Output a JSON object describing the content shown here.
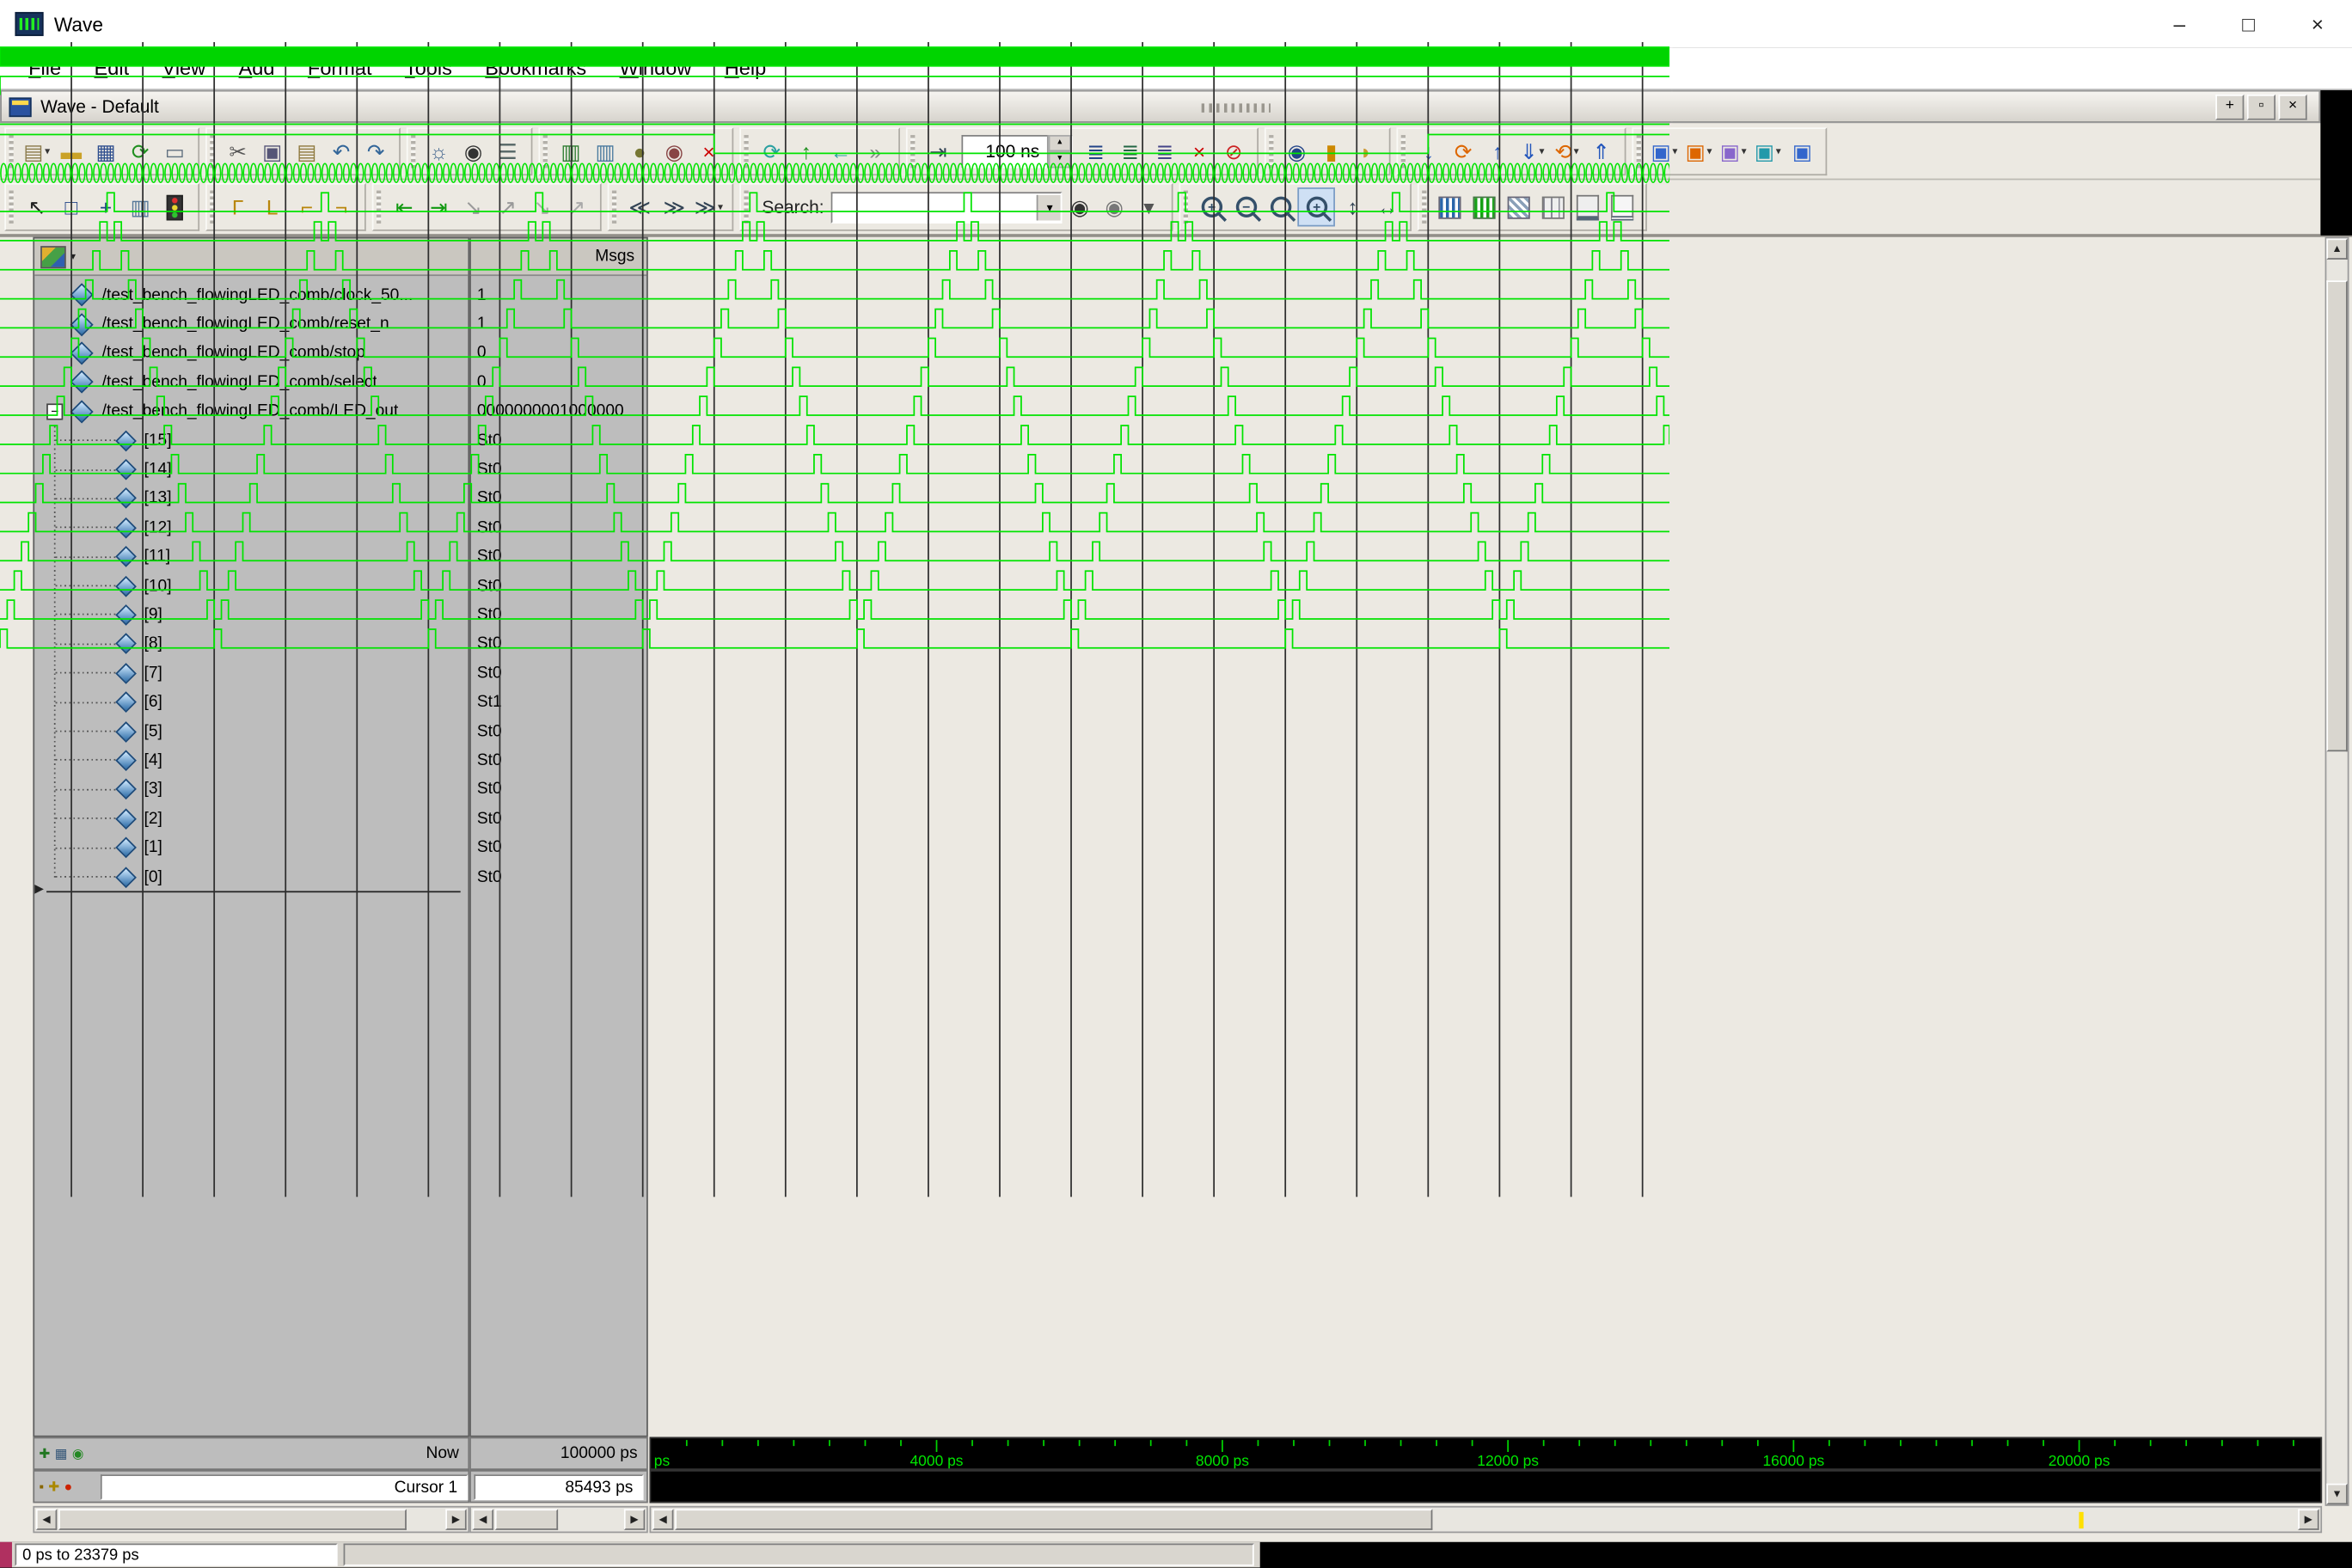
{
  "window": {
    "title": "Wave",
    "minimize": "–",
    "maximize": "□",
    "close": "×"
  },
  "menu": {
    "items": [
      "File",
      "Edit",
      "View",
      "Add",
      "Format",
      "Tools",
      "Bookmarks",
      "Window",
      "Help"
    ]
  },
  "pane": {
    "title": "Wave - Default",
    "buttons": [
      "+",
      "▫",
      "×"
    ]
  },
  "glyphs": {
    "dropdown": "▾",
    "spin_up": "▴",
    "spin_down": "▾",
    "left": "◀",
    "right": "▶",
    "up": "▲",
    "down": "▼",
    "insert_arrow": "▶",
    "expander": "−"
  },
  "run_length": {
    "value": "100 ns"
  },
  "toolbar2_search": {
    "label": "Search:",
    "value": ""
  },
  "columns": {
    "msgs_header": "Msgs"
  },
  "toolbar1": {
    "groups": [
      {
        "name": "file-group",
        "items": [
          {
            "n": "new-document-button",
            "g": "▤",
            "c": "#8a7a4a",
            "dd": 1
          },
          {
            "n": "open-button",
            "g": "▬",
            "c": "#caa227"
          },
          {
            "n": "save-button",
            "g": "▦",
            "c": "#2f4f8f"
          },
          {
            "n": "reload-button",
            "g": "⟳",
            "c": "#1f8f1f"
          },
          {
            "n": "print-button",
            "g": "▭",
            "c": "#5f6f7f"
          }
        ]
      },
      {
        "name": "edit-group",
        "items": [
          {
            "n": "cut-button",
            "g": "✂",
            "c": "#555555"
          },
          {
            "n": "copy-button",
            "g": "▣",
            "c": "#555577"
          },
          {
            "n": "paste-button",
            "g": "▤",
            "c": "#8f7a3f"
          },
          {
            "n": "undo-button",
            "g": "↶",
            "c": "#336699"
          },
          {
            "n": "redo-button",
            "g": "↷",
            "c": "#336699"
          }
        ]
      },
      {
        "name": "find-group",
        "items": [
          {
            "n": "gear-button",
            "g": "☼",
            "c": "#44668f"
          },
          {
            "n": "find-button",
            "g": "◉",
            "c": "#333333"
          },
          {
            "n": "filter-button",
            "g": "☰",
            "c": "#556666"
          }
        ]
      },
      {
        "name": "wave-edit-group",
        "items": [
          {
            "n": "add-wave-button",
            "g": "▥",
            "c": "#2e7d32"
          },
          {
            "n": "insert-wave-button",
            "g": "▥",
            "c": "#4a7a9f"
          },
          {
            "n": "wave-clock-button",
            "g": "●",
            "c": "#777733"
          },
          {
            "n": "wave-compare-button",
            "g": "◉",
            "c": "#884444"
          },
          {
            "n": "wave-delete-button",
            "g": "×",
            "c": "#cc0000"
          }
        ]
      },
      {
        "name": "sim-nav-group",
        "items": [
          {
            "n": "restore-button",
            "g": "⟳",
            "c": "#2aa0a0"
          },
          {
            "n": "up-scope-button",
            "g": "↑",
            "c": "#1f8f1f"
          },
          {
            "n": "back-button",
            "g": "←",
            "c": "#2aa0a0"
          },
          {
            "n": "forward-button",
            "g": "»",
            "c": "#888888"
          }
        ]
      },
      {
        "name": "run-group",
        "items": [
          {
            "n": "goto-time-button",
            "g": "⇥",
            "c": "#334455"
          },
          {
            "t": "runlen"
          },
          {
            "n": "run-button",
            "g": "≣",
            "c": "#224488"
          },
          {
            "n": "run-continue-button",
            "g": "≣",
            "c": "#226644"
          },
          {
            "n": "run-all-button",
            "g": "≣",
            "c": "#444488"
          },
          {
            "n": "stop-button",
            "g": "×",
            "c": "#cc0000"
          },
          {
            "n": "break-button",
            "g": "⊘",
            "c": "#cc2222"
          }
        ]
      },
      {
        "name": "tool-mode-group",
        "items": [
          {
            "n": "examine-button",
            "g": "◉",
            "c": "#224488"
          },
          {
            "n": "force-button",
            "g": "▮",
            "c": "#cc8800"
          },
          {
            "n": "pan-hand-button",
            "g": "◗",
            "c": "#cc9933"
          }
        ]
      },
      {
        "name": "reorder-group",
        "items": [
          {
            "n": "move-down-button",
            "g": "↓",
            "c": "#2255bb"
          },
          {
            "n": "swap-button",
            "g": "⟳",
            "c": "#dd6600"
          },
          {
            "n": "move-up-button",
            "g": "↑",
            "c": "#2255bb"
          },
          {
            "n": "move-bottom-button",
            "g": "⇓",
            "c": "#2255bb",
            "dd": 1
          },
          {
            "n": "reverse-button",
            "g": "⟲",
            "c": "#dd6600",
            "dd": 1
          },
          {
            "n": "move-top-button",
            "g": "⇑",
            "c": "#2255bb"
          }
        ]
      },
      {
        "name": "window-group",
        "items": [
          {
            "n": "pane-add-button",
            "g": "▣",
            "c": "#3366cc",
            "dd": 1
          },
          {
            "n": "pane-dock-button",
            "g": "▣",
            "c": "#dd6600",
            "dd": 1
          },
          {
            "n": "pane-layout-button",
            "g": "▣",
            "c": "#8866cc",
            "dd": 1
          },
          {
            "n": "pane-group-button",
            "g": "▣",
            "c": "#2299aa",
            "dd": 1
          },
          {
            "n": "pane-split-button",
            "g": "▣",
            "c": "#3366cc"
          }
        ]
      }
    ]
  },
  "toolbar2": {
    "groups": [
      {
        "name": "pointer-group",
        "items": [
          {
            "n": "select-mode-button",
            "g": "↖",
            "c": "#222222"
          },
          {
            "n": "zoom-select-button",
            "g": "□",
            "c": "#224488"
          },
          {
            "n": "pan-mode-button",
            "g": "+",
            "c": "#224488"
          },
          {
            "n": "column-layout-button",
            "g": "▥",
            "c": "#557799"
          },
          {
            "n": "stop-drawing-button",
            "t": "traffic"
          }
        ]
      },
      {
        "name": "align-group",
        "items": [
          {
            "n": "align-rise-button",
            "g": "Γ",
            "c": "#b8860b"
          },
          {
            "n": "align-fall-button",
            "g": "L",
            "c": "#b8860b"
          },
          {
            "n": "align-left-button",
            "g": "⌐",
            "c": "#b8860b"
          },
          {
            "n": "align-right-button",
            "g": "¬",
            "c": "#b8860b"
          }
        ]
      },
      {
        "name": "transition-group",
        "items": [
          {
            "n": "prev-transition-button",
            "g": "⇤",
            "c": "#119911"
          },
          {
            "n": "next-transition-button",
            "g": "⇥",
            "c": "#119911"
          },
          {
            "n": "prev-falling-edge-button",
            "g": "↘",
            "c": "#999999"
          },
          {
            "n": "next-falling-edge-button",
            "g": "↗",
            "c": "#999999"
          },
          {
            "n": "prev-rising-edge-button",
            "g": "↘",
            "c": "#aaaaaa"
          },
          {
            "n": "next-rising-edge-button",
            "g": "↗",
            "c": "#aaaaaa"
          }
        ]
      },
      {
        "name": "expand-group",
        "items": [
          {
            "n": "collapse-time-button",
            "g": "≪",
            "c": "#334455"
          },
          {
            "n": "expand-time-button",
            "g": "≫",
            "c": "#334455"
          },
          {
            "n": "expand-all-button",
            "g": "≫",
            "c": "#334455",
            "dd": 1
          }
        ]
      },
      {
        "name": "search-group",
        "items": [
          {
            "t": "searchlabel"
          },
          {
            "t": "searchbox"
          },
          {
            "n": "search-next-button",
            "g": "◉",
            "c": "#333333"
          },
          {
            "n": "search-prev-button",
            "g": "◉",
            "c": "#777777"
          },
          {
            "n": "search-options-button",
            "g": "▾",
            "c": "#555555"
          }
        ]
      },
      {
        "name": "zoom-group",
        "items": [
          {
            "n": "zoom-in-button",
            "t": "mag",
            "sym": "+"
          },
          {
            "n": "zoom-out-button",
            "t": "mag",
            "sym": "−"
          },
          {
            "n": "zoom-full-button",
            "t": "mag",
            "sym": ""
          },
          {
            "n": "zoom-cursor-button",
            "t": "mag",
            "sym": "+",
            "sel": 1
          },
          {
            "n": "zoom-last-button",
            "g": "↕",
            "c": "#334455"
          },
          {
            "n": "zoom-range-button",
            "g": "↔",
            "c": "#334455"
          }
        ]
      },
      {
        "name": "format-group",
        "items": [
          {
            "n": "format-logic-button",
            "t": "fmt",
            "cls": "ic-fmt1"
          },
          {
            "n": "format-analog-button",
            "t": "fmt",
            "cls": "ic-fmt2"
          },
          {
            "n": "format-literal-button",
            "t": "fmt",
            "cls": "ic-fmt3"
          },
          {
            "n": "format-event-button",
            "t": "fmt",
            "cls": "ic-fmt4"
          },
          {
            "n": "format-group-button",
            "t": "fmt",
            "cls": "ic-fmt5"
          },
          {
            "n": "format-ungroup-button",
            "t": "fmt",
            "cls": "ic-fmt6"
          }
        ]
      }
    ]
  },
  "signals": [
    {
      "name": "/test_bench_flowingLED_comb/clock_50...",
      "value": "1",
      "kind": "clock"
    },
    {
      "name": "/test_bench_flowingLED_comb/reset_n",
      "value": "1",
      "kind": "high"
    },
    {
      "name": "/test_bench_flowingLED_comb/stop",
      "value": "0",
      "kind": "low"
    },
    {
      "name": "/test_bench_flowingLED_comb/select",
      "value": "0",
      "kind": "toggle"
    },
    {
      "name": "/test_bench_flowingLED_comb/LED_out",
      "value": "0000000001000000",
      "kind": "bus",
      "expandable": true
    }
  ],
  "bits": [
    {
      "label": "[15]",
      "index": 15,
      "value": "St0"
    },
    {
      "label": "[14]",
      "index": 14,
      "value": "St0"
    },
    {
      "label": "[13]",
      "index": 13,
      "value": "St0"
    },
    {
      "label": "[12]",
      "index": 12,
      "value": "St0"
    },
    {
      "label": "[11]",
      "index": 11,
      "value": "St0"
    },
    {
      "label": "[10]",
      "index": 10,
      "value": "St0"
    },
    {
      "label": "[9]",
      "index": 9,
      "value": "St0"
    },
    {
      "label": "[8]",
      "index": 8,
      "value": "St0"
    },
    {
      "label": "[7]",
      "index": 7,
      "value": "St0"
    },
    {
      "label": "[6]",
      "index": 6,
      "value": "St1"
    },
    {
      "label": "[5]",
      "index": 5,
      "value": "St0"
    },
    {
      "label": "[4]",
      "index": 4,
      "value": "St0"
    },
    {
      "label": "[3]",
      "index": 3,
      "value": "St0"
    },
    {
      "label": "[2]",
      "index": 2,
      "value": "St0"
    },
    {
      "label": "[1]",
      "index": 1,
      "value": "St0"
    },
    {
      "label": "[0]",
      "index": 0,
      "value": "St0"
    }
  ],
  "rows_bottom": {
    "now_label": "Now",
    "now_value": "100000 ps",
    "cursor_label": "Cursor 1",
    "cursor_value": "85493 ps",
    "now_icons": [
      {
        "n": "add-cursor-button",
        "g": "✚",
        "c": "#227722"
      },
      {
        "n": "cursor-properties-button",
        "g": "▦",
        "c": "#335577"
      },
      {
        "n": "cursor-sync-button",
        "g": "◉",
        "c": "#228822"
      }
    ],
    "cursor_icons": [
      {
        "n": "cursor-lock-icon",
        "g": "▪",
        "c": "#886600"
      },
      {
        "n": "cursor-edit-icon",
        "g": "✚",
        "c": "#aa8800"
      },
      {
        "n": "cursor-delete-button",
        "g": "●",
        "c": "#cc2200"
      }
    ]
  },
  "timeline": {
    "origin_label": "ps",
    "ticks": [
      {
        "t": 4000,
        "label": "4000 ps"
      },
      {
        "t": 8000,
        "label": "8000 ps"
      },
      {
        "t": 12000,
        "label": "12000 ps"
      },
      {
        "t": 16000,
        "label": "16000 ps"
      },
      {
        "t": 20000,
        "label": "20000 ps"
      }
    ]
  },
  "status": {
    "range": "0 ps to 23379 ps"
  },
  "wave": {
    "t_end": 23379,
    "grid_ps": 1000,
    "minor_ps": 500,
    "major_ps": 4000,
    "step_ps": 100,
    "led_bits": 16,
    "pingpong_sequence_length": 30,
    "select_toggles": [
      10000,
      20000
    ],
    "green": "#00e400"
  }
}
